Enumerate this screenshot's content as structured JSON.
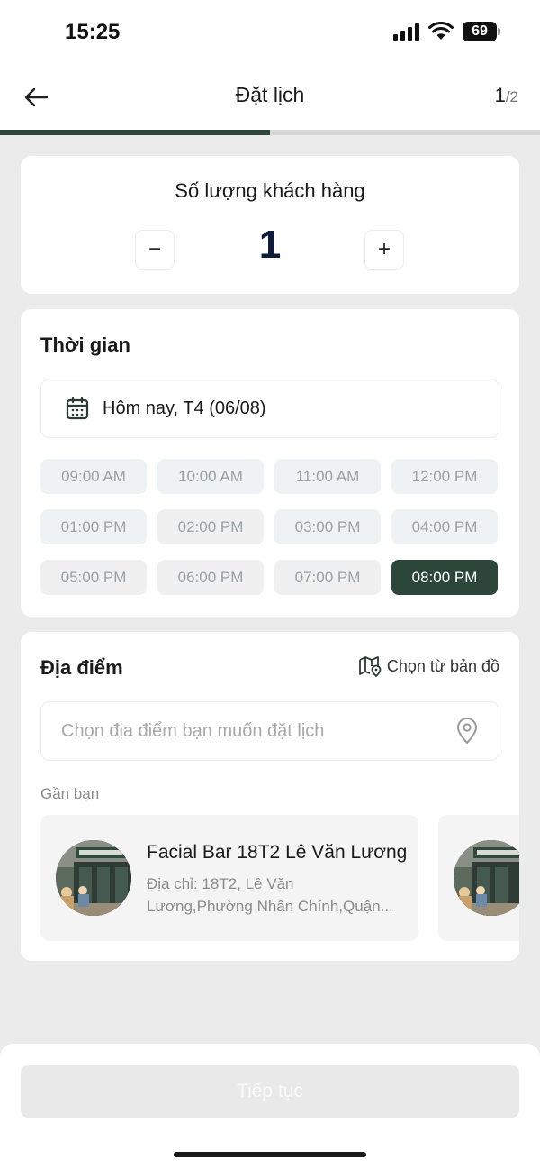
{
  "status_bar": {
    "time": "15:25",
    "battery": "69"
  },
  "header": {
    "title": "Đặt lịch",
    "step_current": "1",
    "step_total": "/2"
  },
  "progress": {
    "fraction": 0.5,
    "color": "#2c473a"
  },
  "quantity": {
    "title": "Số lượng khách hàng",
    "value": "1",
    "minus": "−",
    "plus": "+"
  },
  "time_section": {
    "title": "Thời gian",
    "date_label": "Hôm nay, T4 (06/08)",
    "slots": [
      "09:00 AM",
      "10:00 AM",
      "11:00 AM",
      "12:00 PM",
      "01:00 PM",
      "02:00 PM",
      "03:00 PM",
      "04:00 PM",
      "05:00 PM",
      "06:00 PM",
      "07:00 PM",
      "08:00 PM"
    ],
    "selected_slot": "08:00 PM"
  },
  "location_section": {
    "title": "Địa điểm",
    "map_link": "Chọn từ bản đồ",
    "search_placeholder": "Chọn địa điểm bạn muốn đặt lịch",
    "near_label": "Gần bạn",
    "places": [
      {
        "name": "Facial Bar 18T2 Lê Văn Lương",
        "address_line1": "Địa chỉ: 18T2, Lê Văn",
        "address_line2": "Lương,Phường Nhân Chính,Quận..."
      }
    ]
  },
  "footer": {
    "continue_label": "Tiếp tục"
  },
  "colors": {
    "accent": "#2c473a",
    "page_bg": "#ebebeb",
    "card_bg": "#ffffff"
  }
}
